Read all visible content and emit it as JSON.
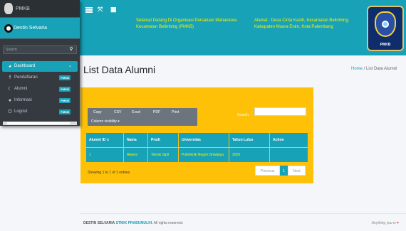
{
  "app": {
    "brand": "PMKB",
    "user_name": "Destin Selvaria",
    "search_placeholder": "Search"
  },
  "sidebar": {
    "items": [
      {
        "label": "Dashboard",
        "icon": "dashboard-icon"
      },
      {
        "label": "Pendaftaran",
        "badge": "PMKB",
        "icon": "person-icon"
      },
      {
        "label": "Alumni",
        "badge": "PMKB",
        "icon": "alumni-icon"
      },
      {
        "label": "Informasi",
        "badge": "PMKB",
        "icon": "info-icon"
      },
      {
        "label": "Logout",
        "badge": "PMKB",
        "icon": "power-icon"
      }
    ]
  },
  "header": {
    "welcome": "Selamat Datang Di Organisasi Persatuan Mahasiswa Kecamatan Belimbing (PMKB)",
    "address": "Alamat : Desa Cinta Kasih, Kecamatan Belimbing, Kabupaten Muara Enim, Kota Palembang",
    "logo_text": "PMKB"
  },
  "page": {
    "title": "List Data Alumni",
    "breadcrumb_home": "Home",
    "breadcrumb_sep": "/",
    "breadcrumb_current": "List Data Alumni"
  },
  "table": {
    "buttons": [
      "Copy",
      "CSV",
      "Excel",
      "PDF",
      "Print"
    ],
    "column_visibility": "Column visibility",
    "search_label": "Search:",
    "columns": [
      "Alumni ID",
      "Nama",
      "Prodi",
      "Universitas",
      "Tahun Lulus",
      "Action"
    ],
    "rows": [
      [
        "1",
        "Alwani",
        "Teknik Sipil",
        "Politeknik Negeri Sriwijaya",
        "2020",
        ""
      ]
    ],
    "info": "Showing 1 to 1 of 1 entries",
    "pager": {
      "previous": "Previous",
      "current": "1",
      "next": "Next"
    }
  },
  "footer": {
    "author": "DESTIN SELVARIA",
    "site": "STMIK PRABUMULIH.",
    "rights": "All rights reserved.",
    "right_text": "Anything you w"
  },
  "colors": {
    "accent": "#17a2b8",
    "card": "#ffc107",
    "sidebar": "#343a40",
    "highlight_text": "#fff100"
  }
}
